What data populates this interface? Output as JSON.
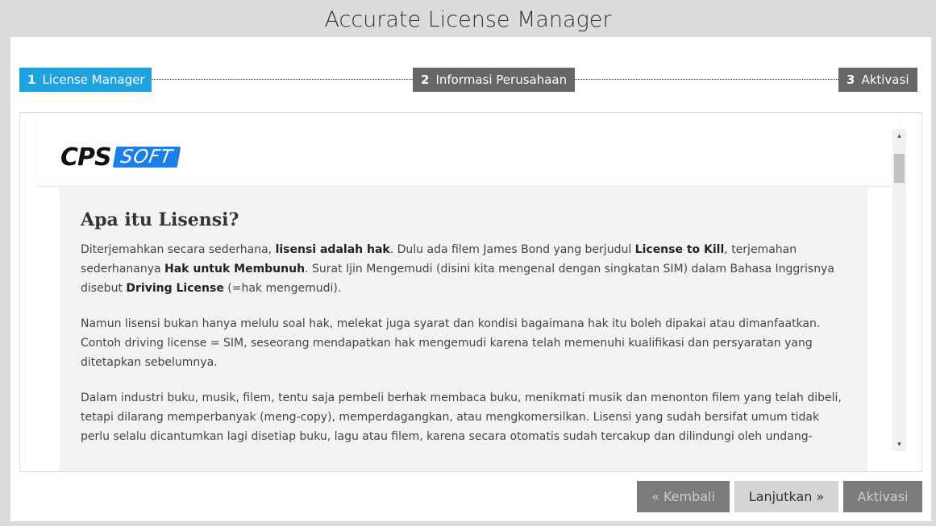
{
  "window": {
    "title": "Accurate License Manager"
  },
  "steps": [
    {
      "num": "1",
      "label": "License Manager",
      "state": "active"
    },
    {
      "num": "2",
      "label": "Informasi Perusahaan",
      "state": "inactive"
    },
    {
      "num": "3",
      "label": "Aktivasi",
      "state": "inactive"
    }
  ],
  "logo": {
    "part1": "CPS",
    "part2": "SOFT"
  },
  "article": {
    "heading": "Apa itu Lisensi?",
    "p1": {
      "a": "Diterjemahkan secara sederhana, ",
      "b": "lisensi adalah hak",
      "c": ". Dulu ada filem James Bond yang berjudul ",
      "d": "License to Kill",
      "e": ", terjemahan sederhananya ",
      "f": "Hak untuk Membunuh",
      "g": ". Surat Ijin Mengemudi (disini kita mengenal dengan singkatan SIM) dalam Bahasa Inggrisnya disebut ",
      "h": "Driving License",
      "i": " (=hak mengemudi)."
    },
    "p2": "Namun lisensi bukan hanya melulu soal hak, melekat juga syarat dan kondisi bagaimana hak itu boleh dipakai atau dimanfaatkan. Contoh driving license = SIM, seseorang mendapatkan hak mengemudi karena telah memenuhi kualifikasi dan persyaratan yang ditetapkan sebelumnya.",
    "p3": "Dalam industri buku, musik, filem, tentu saja pembeli berhak membaca buku, menikmati musik dan menonton filem yang telah dibeli, tetapi dilarang memperbanyak (meng-copy), memperdagangkan, atau mengkomersilkan. Lisensi yang sudah bersifat umum tidak perlu selalu dicantumkan lagi disetiap buku, lagu atau filem, karena secara otomatis sudah tercakup dan dilindungi oleh undang-"
  },
  "buttons": {
    "back": "« Kembali",
    "next": "Lanjutkan »",
    "activate": "Aktivasi"
  },
  "icons": {
    "scroll_up": "▲",
    "scroll_down": "▼"
  }
}
